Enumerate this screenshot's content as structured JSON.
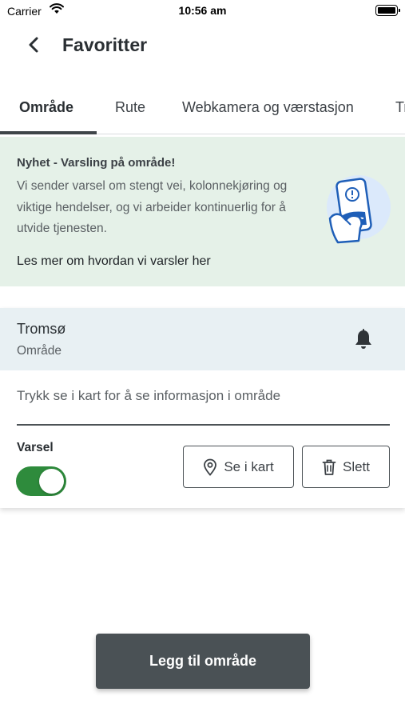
{
  "status_bar": {
    "carrier": "Carrier",
    "time": "10:56 am"
  },
  "nav": {
    "title": "Favoritter",
    "back_icon": "chevron-left-icon"
  },
  "tabs": [
    {
      "label": "Område",
      "active": true
    },
    {
      "label": "Rute",
      "active": false
    },
    {
      "label": "Webkamera og værstasjon",
      "active": false
    },
    {
      "label": "Tr",
      "active": false
    }
  ],
  "banner": {
    "title": "Nyhet - Varsling på område!",
    "body_lines": [
      "Vi sender varsel om stengt vei, kolonnekjøring og",
      "viktige hendelser, og vi arbeider kontinuerlig for å",
      "utvide tjenesten."
    ],
    "link": "Les mer om hvordan vi varsler her",
    "illustration": "phone-notification-illustration"
  },
  "favorite": {
    "name": "Tromsø",
    "type": "Område",
    "bell_icon": "bell-icon",
    "map_hint": "Trykk se i kart for å se informasjon i område",
    "alert_label": "Varsel",
    "alert_enabled": true,
    "map_button": "Se i kart",
    "delete_button": "Slett"
  },
  "add_button": "Legg til område",
  "colors": {
    "banner_bg": "#e5f1e8",
    "card_header_bg": "#e8f0f3",
    "toggle_on": "#2e8b3c",
    "primary_button": "#4a5155",
    "illustration_blue": "#1f5fb8"
  }
}
